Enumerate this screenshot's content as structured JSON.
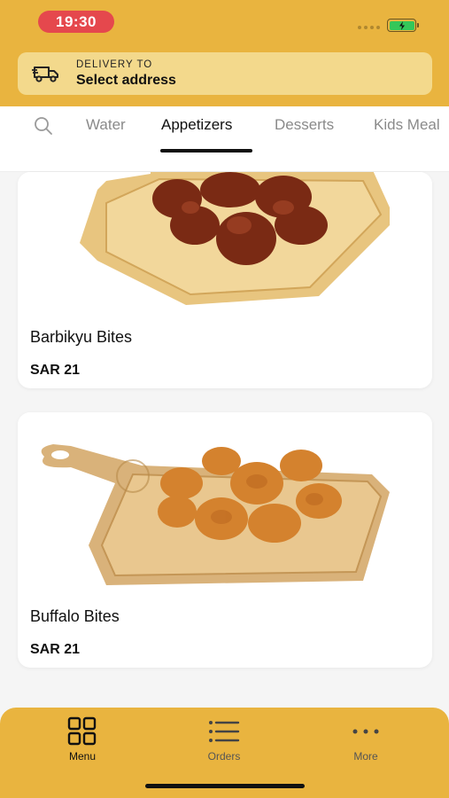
{
  "status_bar": {
    "time": "19:30"
  },
  "delivery": {
    "label": "DELIVERY TO",
    "value": "Select address",
    "icon": "delivery-truck-icon"
  },
  "tabs": [
    {
      "label": "Water",
      "active": false
    },
    {
      "label": "Appetizers",
      "active": true
    },
    {
      "label": "Desserts",
      "active": false
    },
    {
      "label": "Kids Meal",
      "active": false
    }
  ],
  "items": [
    {
      "name": "Barbikyu Bites",
      "price": "SAR 21"
    },
    {
      "name": "Buffalo Bites",
      "price": "SAR 21"
    }
  ],
  "bottom_nav": [
    {
      "label": "Menu",
      "icon": "grid-icon",
      "active": true
    },
    {
      "label": "Orders",
      "icon": "list-icon",
      "active": false
    },
    {
      "label": "More",
      "icon": "more-dots-icon",
      "active": false
    }
  ],
  "colors": {
    "brand": "#e9b43f",
    "delivery_bg": "#f3d98c",
    "time_pill": "#e5484d"
  }
}
